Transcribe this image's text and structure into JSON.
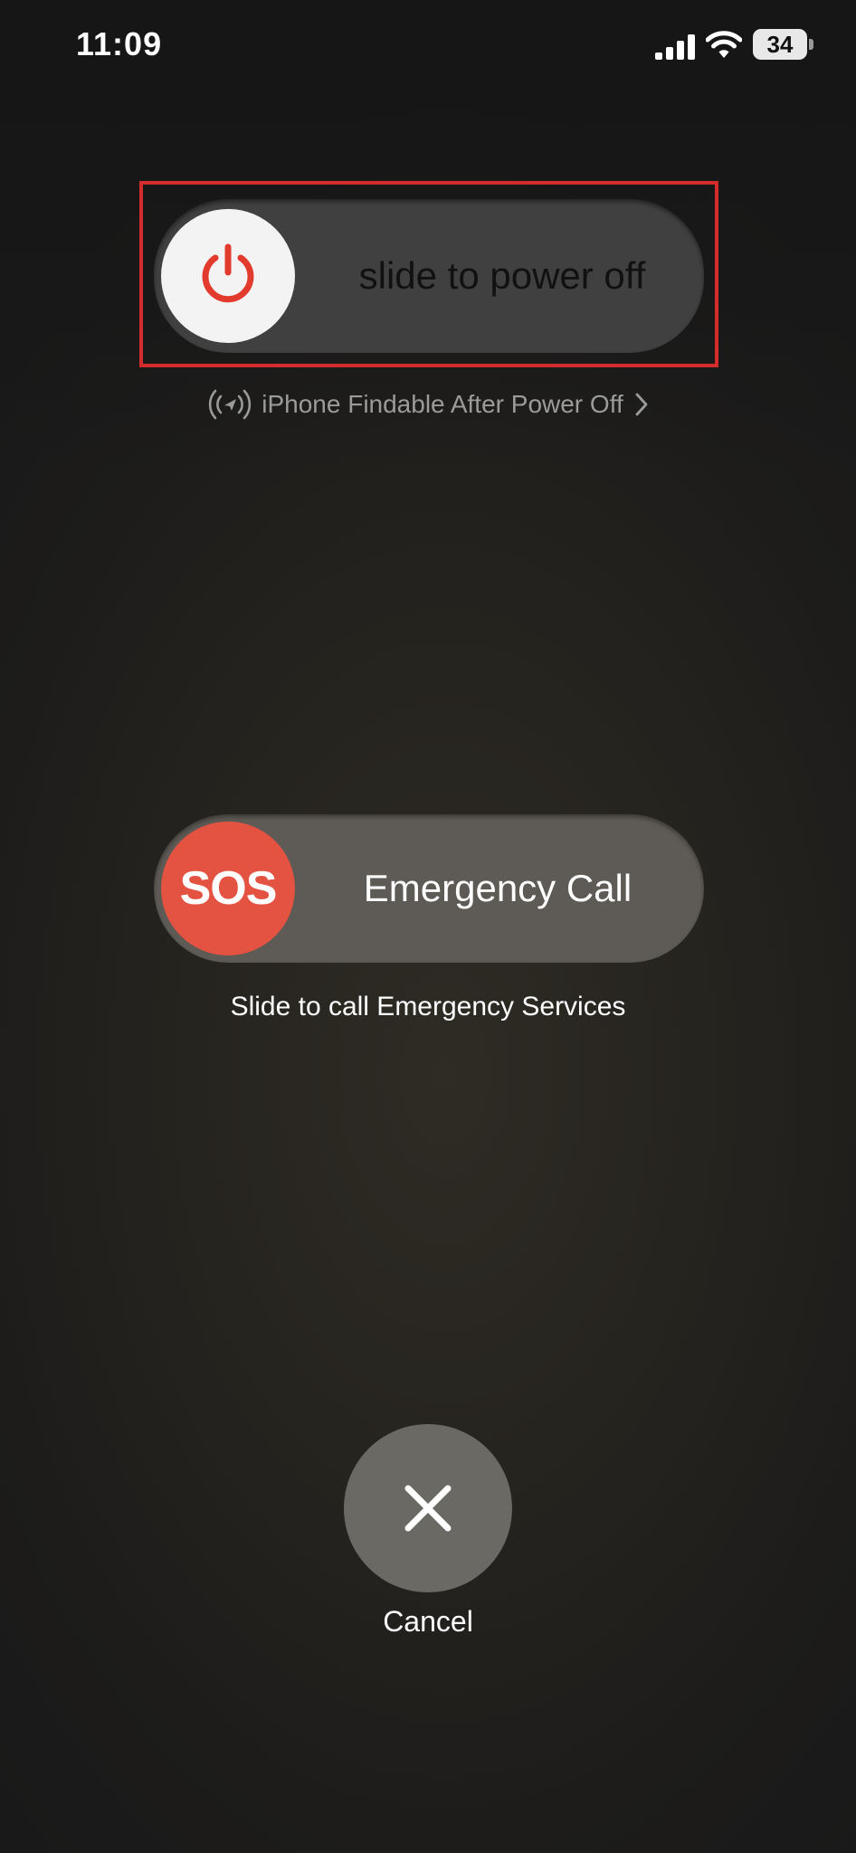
{
  "status_bar": {
    "time": "11:09",
    "battery_level": "34",
    "icons": [
      "cellular-signal-icon",
      "wifi-icon",
      "battery-icon"
    ]
  },
  "power_slider": {
    "label": "slide to power off",
    "knob_icon": "power-icon"
  },
  "findable": {
    "icon": "find-my-icon",
    "label": "iPhone Findable After Power Off",
    "chevron_icon": "chevron-right-icon"
  },
  "sos_slider": {
    "knob_text": "SOS",
    "label": "Emergency Call",
    "caption": "Slide to call Emergency Services"
  },
  "cancel": {
    "icon": "close-icon",
    "label": "Cancel"
  },
  "colors": {
    "highlight": "#d22c2c",
    "power_icon": "#e23b2e",
    "sos_knob": "#e45241"
  }
}
